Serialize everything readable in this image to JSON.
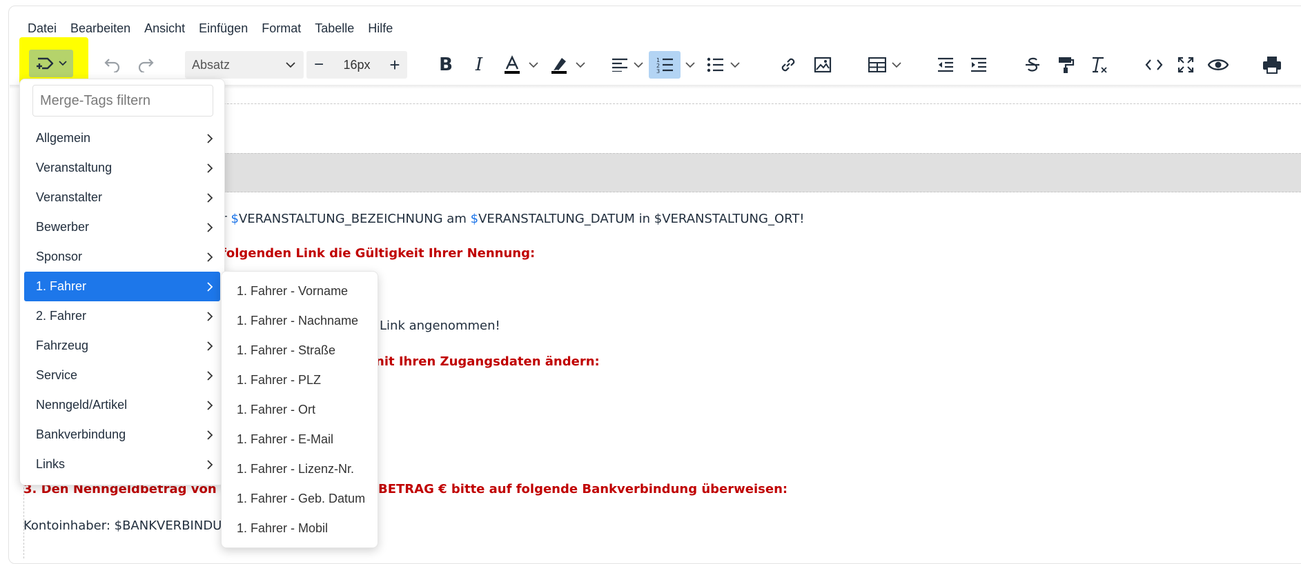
{
  "menubar": [
    "Datei",
    "Bearbeiten",
    "Ansicht",
    "Einfügen",
    "Format",
    "Tabelle",
    "Hilfe"
  ],
  "toolbar": {
    "block_format": "Absatz",
    "font_size": "16px",
    "decrease_label": "−",
    "increase_label": "+"
  },
  "dropdown": {
    "filter_placeholder": "Merge-Tags filtern",
    "items": [
      {
        "label": "Allgemein"
      },
      {
        "label": "Veranstaltung"
      },
      {
        "label": "Veranstalter"
      },
      {
        "label": "Bewerber"
      },
      {
        "label": "Sponsor"
      },
      {
        "label": "1. Fahrer"
      },
      {
        "label": "2. Fahrer"
      },
      {
        "label": "Fahrzeug"
      },
      {
        "label": "Service"
      },
      {
        "label": "Nenngeld/Artikel"
      },
      {
        "label": "Bankverbindung"
      },
      {
        "label": "Links"
      }
    ],
    "active_item": "1. Fahrer"
  },
  "submenu": {
    "items": [
      "1. Fahrer - Vorname",
      "1. Fahrer - Nachname",
      "1. Fahrer - Straße",
      "1. Fahrer - PLZ",
      "1. Fahrer - Ort",
      "1. Fahrer - E-Mail",
      "1. Fahrer - Lizenz-Nr.",
      "1. Fahrer - Geb. Datum",
      "1. Fahrer - Mobil"
    ]
  },
  "document": {
    "line1_prefix": "ur ",
    "line1_dollar1": "$",
    "line1_mid1": "VERANSTALTUNG_BEZEICHNUNG am ",
    "line1_dollar2": "$",
    "line1_rest": "VERANSTALTUNG_DATUM in $VERANSTALTUNG_ORT!",
    "line2": "folgenden Link die Gültigkeit Ihrer Nennung:",
    "line3": "Link angenommen!",
    "line4": "nit Ihren Zugangsdaten ändern:",
    "line5_left": "3. Den Nenngeldbetrag von",
    "line5_right": "BETRAG € bitte auf folgende Bankverbindung überweisen:",
    "line6": "Kontoinhaber: $BANKVERBINDU"
  },
  "colors": {
    "accent": "#1d77ea",
    "highlight": "#ffff00",
    "merge_button": "#b5d36b",
    "emphasis_red": "#c00000"
  }
}
